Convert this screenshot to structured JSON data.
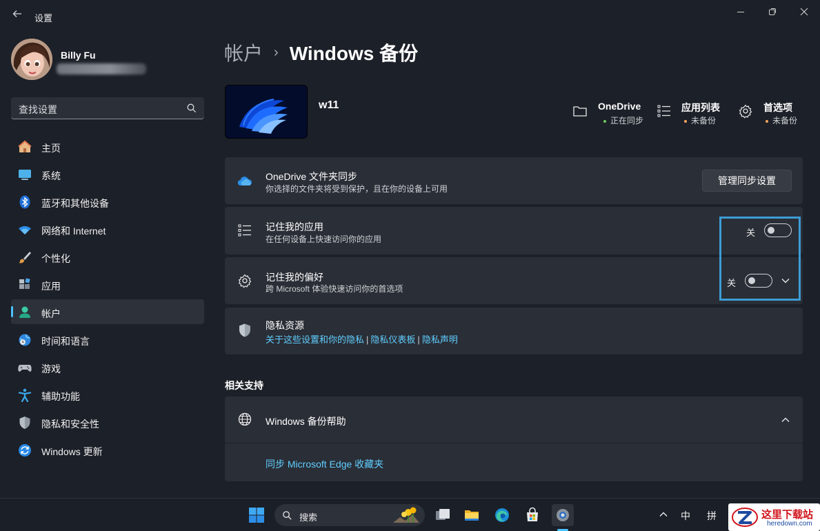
{
  "window": {
    "title": "设置",
    "back_icon": "arrow-left-icon"
  },
  "profile": {
    "name": "Billy Fu"
  },
  "search": {
    "placeholder": "查找设置"
  },
  "nav": [
    {
      "label": "主页",
      "icon": "home-icon"
    },
    {
      "label": "系统",
      "icon": "monitor-icon"
    },
    {
      "label": "蓝牙和其他设备",
      "icon": "bluetooth-icon"
    },
    {
      "label": "网络和 Internet",
      "icon": "wifi-icon"
    },
    {
      "label": "个性化",
      "icon": "brush-icon"
    },
    {
      "label": "应用",
      "icon": "apps-icon"
    },
    {
      "label": "帐户",
      "icon": "account-icon",
      "active": true
    },
    {
      "label": "时间和语言",
      "icon": "globe-clock-icon"
    },
    {
      "label": "游戏",
      "icon": "gamepad-icon"
    },
    {
      "label": "辅助功能",
      "icon": "accessibility-icon"
    },
    {
      "label": "隐私和安全性",
      "icon": "shield-icon"
    },
    {
      "label": "Windows 更新",
      "icon": "update-icon"
    }
  ],
  "breadcrumb": {
    "parent": "帐户",
    "separator": "›",
    "current": "Windows 备份"
  },
  "device": {
    "name": "w11"
  },
  "status": [
    {
      "title": "OneDrive",
      "status": "正在同步",
      "icon": "folder-icon",
      "color": "#6ccb5f"
    },
    {
      "title": "应用列表",
      "status": "未备份",
      "icon": "list-icon",
      "color": "#f7a35c"
    },
    {
      "title": "首选项",
      "status": "未备份",
      "icon": "gear-icon",
      "color": "#f7a35c"
    }
  ],
  "onedrive_card": {
    "title": "OneDrive 文件夹同步",
    "subtitle": "你选择的文件夹将受到保护，且在你的设备上可用",
    "button": "管理同步设置"
  },
  "apps_card": {
    "title": "记住我的应用",
    "subtitle": "在任何设备上快速访问你的应用",
    "toggle_label": "关"
  },
  "prefs_card": {
    "title": "记住我的偏好",
    "subtitle": "跨 Microsoft 体验快速访问你的首选项",
    "toggle_label": "关"
  },
  "privacy_card": {
    "title": "隐私资源",
    "links": [
      "关于这些设置和你的隐私",
      "隐私仪表板",
      "隐私声明"
    ],
    "separator": "|"
  },
  "related": {
    "section_title": "相关支持",
    "help_title": "Windows 备份帮助",
    "help_link": "同步 Microsoft Edge 收藏夹"
  },
  "taskbar": {
    "search_label": "搜索",
    "ime_lang": "中",
    "ime_mode": "拼",
    "watermark_title": "这里下载站",
    "watermark_sub": "heredown.com"
  },
  "colors": {
    "accent": "#4cc2ff",
    "link": "#60cdff",
    "highlight": "#3d9dd6"
  }
}
